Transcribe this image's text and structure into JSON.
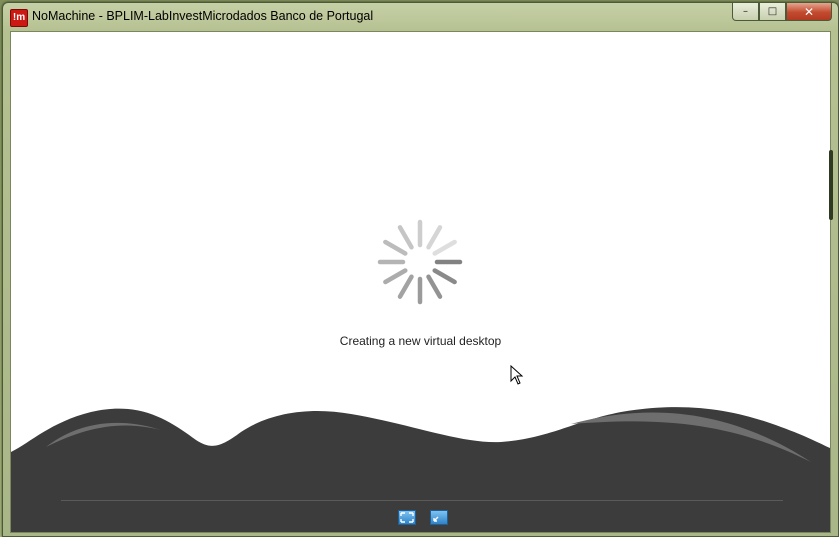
{
  "window": {
    "title": "NoMachine - BPLIM-LabInvestMicrodados Banco de Portugal",
    "app_icon_text": "!m",
    "buttons": {
      "minimize": "–",
      "maximize": "□",
      "close": "✕"
    }
  },
  "status": {
    "message": "Creating a new virtual desktop"
  },
  "icons": {
    "spinner": "loading-spinner-icon",
    "fullscreen": "fullscreen-icon",
    "fit": "fit-window-icon"
  },
  "colors": {
    "hill": "#3c3c3c",
    "hill_highlight": "#6e6e6e",
    "client_bg": "#ffffff",
    "close_button": "#c34a2f",
    "toolbar_button": "#3a8fd4"
  }
}
